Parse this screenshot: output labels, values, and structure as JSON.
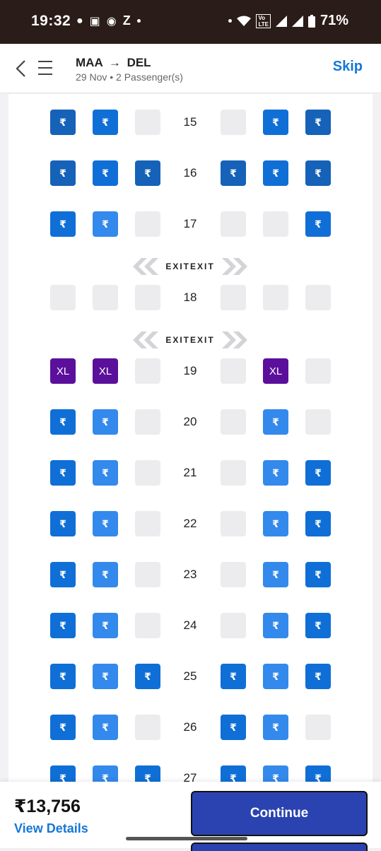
{
  "status": {
    "time": "19:32",
    "notifications": [
      "chat-icon",
      "teams-icon",
      "app-icon",
      "Z"
    ],
    "battery": "71%"
  },
  "header": {
    "from": "MAA",
    "to": "DEL",
    "arrow": "→",
    "subtitle": "29 Nov • 2 Passenger(s)",
    "skip_label": "Skip"
  },
  "exit_label": "EXITEXIT",
  "seat_symbol": "₹",
  "rows": [
    {
      "num": "15",
      "seats": [
        "dark",
        "bright",
        "empty",
        "empty",
        "bright",
        "dark"
      ]
    },
    {
      "num": "16",
      "seats": [
        "dark",
        "bright",
        "dark",
        "dark",
        "bright",
        "dark"
      ]
    },
    {
      "num": "17",
      "seats": [
        "bright",
        "light",
        "empty",
        "empty",
        "empty",
        "bright"
      ]
    },
    {
      "num": "18",
      "seats": [
        "empty",
        "empty",
        "empty",
        "empty",
        "empty",
        "empty"
      ]
    },
    {
      "num": "19",
      "seats": [
        "xl",
        "xl",
        "empty",
        "empty",
        "xl",
        "empty"
      ]
    },
    {
      "num": "20",
      "seats": [
        "bright",
        "light",
        "empty",
        "empty",
        "light",
        "empty"
      ]
    },
    {
      "num": "21",
      "seats": [
        "bright",
        "light",
        "empty",
        "empty",
        "light",
        "bright"
      ]
    },
    {
      "num": "22",
      "seats": [
        "bright",
        "light",
        "empty",
        "empty",
        "light",
        "bright"
      ]
    },
    {
      "num": "23",
      "seats": [
        "bright",
        "light",
        "empty",
        "empty",
        "light",
        "bright"
      ]
    },
    {
      "num": "24",
      "seats": [
        "bright",
        "light",
        "empty",
        "empty",
        "light",
        "bright"
      ]
    },
    {
      "num": "25",
      "seats": [
        "bright",
        "light",
        "bright",
        "bright",
        "light",
        "bright"
      ]
    },
    {
      "num": "26",
      "seats": [
        "bright",
        "light",
        "empty",
        "bright",
        "light",
        "empty"
      ]
    },
    {
      "num": "27",
      "seats": [
        "bright",
        "light",
        "bright",
        "bright",
        "light",
        "bright"
      ]
    }
  ],
  "xl_label": "XL",
  "footer": {
    "price": "₹13,756",
    "view_details": "View Details",
    "continue_label": "Continue"
  },
  "colors": {
    "seat_dark": "#1562b8",
    "seat_bright": "#0f6fd6",
    "seat_light": "#3389ec",
    "seat_xl": "#5b109c",
    "seat_empty": "#ececee",
    "accent": "#1777d6",
    "continue": "#2b43b0"
  }
}
